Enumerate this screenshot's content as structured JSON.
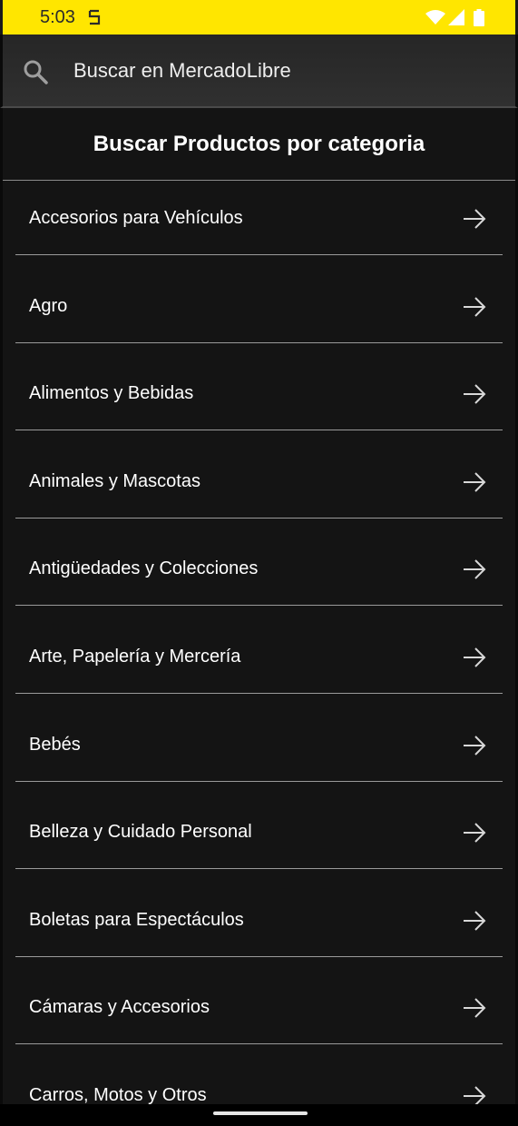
{
  "status_bar": {
    "time": "5:03",
    "background_color": "#ffe600",
    "icons": [
      "s-app-icon",
      "wifi-icon",
      "signal-icon",
      "battery-icon"
    ]
  },
  "search": {
    "placeholder": "Buscar en MercadoLibre",
    "icon": "search-icon"
  },
  "section": {
    "title": "Buscar Productos por categoria"
  },
  "categories": [
    {
      "label": "Accesorios para Vehículos",
      "icon": "arrow-right-icon"
    },
    {
      "label": "Agro",
      "icon": "arrow-right-icon"
    },
    {
      "label": "Alimentos y Bebidas",
      "icon": "arrow-right-icon"
    },
    {
      "label": "Animales y Mascotas",
      "icon": "arrow-right-icon"
    },
    {
      "label": "Antigüedades y Colecciones",
      "icon": "arrow-right-icon"
    },
    {
      "label": "Arte, Papelería y Mercería",
      "icon": "arrow-right-icon"
    },
    {
      "label": "Bebés",
      "icon": "arrow-right-icon"
    },
    {
      "label": "Belleza y Cuidado Personal",
      "icon": "arrow-right-icon"
    },
    {
      "label": "Boletas para Espectáculos",
      "icon": "arrow-right-icon"
    },
    {
      "label": "Cámaras y Accesorios",
      "icon": "arrow-right-icon"
    },
    {
      "label": "Carros, Motos y Otros",
      "icon": "arrow-right-icon"
    }
  ]
}
